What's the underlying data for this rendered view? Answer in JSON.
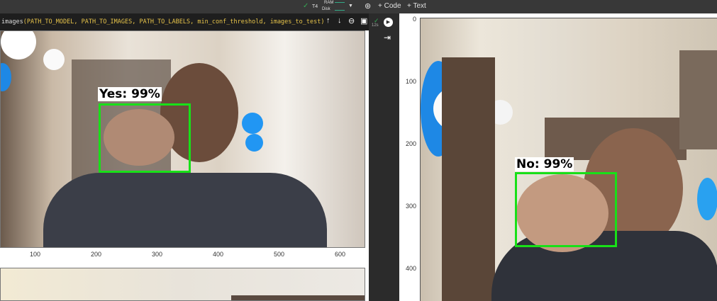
{
  "toolbar": {
    "runtime": "T4",
    "ram_label": "RAM",
    "disk_label": "Disk",
    "add_code": "+ Code",
    "add_text": "+ Text"
  },
  "cell": {
    "code_func": "images",
    "code_args": "(PATH_TO_MODEL, PATH_TO_IMAGES, PATH_TO_LABELS, min_conf_threshold, images_to_test)",
    "exec_time": "12s"
  },
  "left_plot": {
    "detection_label": "Yes: 99%",
    "x_ticks": [
      "100",
      "200",
      "300",
      "400",
      "500",
      "600"
    ]
  },
  "right_plot": {
    "detection_label": "No: 99%",
    "y_ticks": [
      "0",
      "100",
      "200",
      "300",
      "400"
    ]
  },
  "colors": {
    "box": "#18e018",
    "check": "#34a853"
  }
}
